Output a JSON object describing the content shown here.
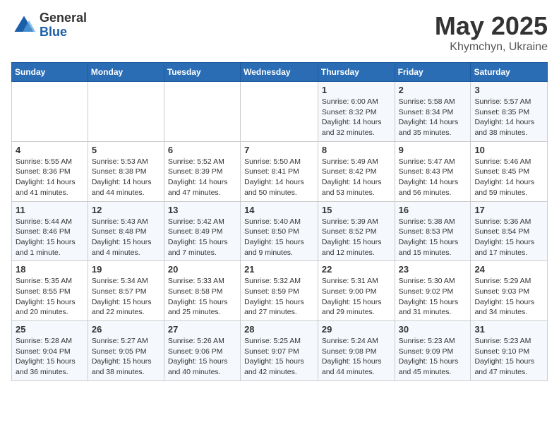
{
  "header": {
    "logo_general": "General",
    "logo_blue": "Blue",
    "month": "May 2025",
    "location": "Khymchyn, Ukraine"
  },
  "weekdays": [
    "Sunday",
    "Monday",
    "Tuesday",
    "Wednesday",
    "Thursday",
    "Friday",
    "Saturday"
  ],
  "weeks": [
    [
      {
        "day": "",
        "info": ""
      },
      {
        "day": "",
        "info": ""
      },
      {
        "day": "",
        "info": ""
      },
      {
        "day": "",
        "info": ""
      },
      {
        "day": "1",
        "info": "Sunrise: 6:00 AM\nSunset: 8:32 PM\nDaylight: 14 hours\nand 32 minutes."
      },
      {
        "day": "2",
        "info": "Sunrise: 5:58 AM\nSunset: 8:34 PM\nDaylight: 14 hours\nand 35 minutes."
      },
      {
        "day": "3",
        "info": "Sunrise: 5:57 AM\nSunset: 8:35 PM\nDaylight: 14 hours\nand 38 minutes."
      }
    ],
    [
      {
        "day": "4",
        "info": "Sunrise: 5:55 AM\nSunset: 8:36 PM\nDaylight: 14 hours\nand 41 minutes."
      },
      {
        "day": "5",
        "info": "Sunrise: 5:53 AM\nSunset: 8:38 PM\nDaylight: 14 hours\nand 44 minutes."
      },
      {
        "day": "6",
        "info": "Sunrise: 5:52 AM\nSunset: 8:39 PM\nDaylight: 14 hours\nand 47 minutes."
      },
      {
        "day": "7",
        "info": "Sunrise: 5:50 AM\nSunset: 8:41 PM\nDaylight: 14 hours\nand 50 minutes."
      },
      {
        "day": "8",
        "info": "Sunrise: 5:49 AM\nSunset: 8:42 PM\nDaylight: 14 hours\nand 53 minutes."
      },
      {
        "day": "9",
        "info": "Sunrise: 5:47 AM\nSunset: 8:43 PM\nDaylight: 14 hours\nand 56 minutes."
      },
      {
        "day": "10",
        "info": "Sunrise: 5:46 AM\nSunset: 8:45 PM\nDaylight: 14 hours\nand 59 minutes."
      }
    ],
    [
      {
        "day": "11",
        "info": "Sunrise: 5:44 AM\nSunset: 8:46 PM\nDaylight: 15 hours\nand 1 minute."
      },
      {
        "day": "12",
        "info": "Sunrise: 5:43 AM\nSunset: 8:48 PM\nDaylight: 15 hours\nand 4 minutes."
      },
      {
        "day": "13",
        "info": "Sunrise: 5:42 AM\nSunset: 8:49 PM\nDaylight: 15 hours\nand 7 minutes."
      },
      {
        "day": "14",
        "info": "Sunrise: 5:40 AM\nSunset: 8:50 PM\nDaylight: 15 hours\nand 9 minutes."
      },
      {
        "day": "15",
        "info": "Sunrise: 5:39 AM\nSunset: 8:52 PM\nDaylight: 15 hours\nand 12 minutes."
      },
      {
        "day": "16",
        "info": "Sunrise: 5:38 AM\nSunset: 8:53 PM\nDaylight: 15 hours\nand 15 minutes."
      },
      {
        "day": "17",
        "info": "Sunrise: 5:36 AM\nSunset: 8:54 PM\nDaylight: 15 hours\nand 17 minutes."
      }
    ],
    [
      {
        "day": "18",
        "info": "Sunrise: 5:35 AM\nSunset: 8:55 PM\nDaylight: 15 hours\nand 20 minutes."
      },
      {
        "day": "19",
        "info": "Sunrise: 5:34 AM\nSunset: 8:57 PM\nDaylight: 15 hours\nand 22 minutes."
      },
      {
        "day": "20",
        "info": "Sunrise: 5:33 AM\nSunset: 8:58 PM\nDaylight: 15 hours\nand 25 minutes."
      },
      {
        "day": "21",
        "info": "Sunrise: 5:32 AM\nSunset: 8:59 PM\nDaylight: 15 hours\nand 27 minutes."
      },
      {
        "day": "22",
        "info": "Sunrise: 5:31 AM\nSunset: 9:00 PM\nDaylight: 15 hours\nand 29 minutes."
      },
      {
        "day": "23",
        "info": "Sunrise: 5:30 AM\nSunset: 9:02 PM\nDaylight: 15 hours\nand 31 minutes."
      },
      {
        "day": "24",
        "info": "Sunrise: 5:29 AM\nSunset: 9:03 PM\nDaylight: 15 hours\nand 34 minutes."
      }
    ],
    [
      {
        "day": "25",
        "info": "Sunrise: 5:28 AM\nSunset: 9:04 PM\nDaylight: 15 hours\nand 36 minutes."
      },
      {
        "day": "26",
        "info": "Sunrise: 5:27 AM\nSunset: 9:05 PM\nDaylight: 15 hours\nand 38 minutes."
      },
      {
        "day": "27",
        "info": "Sunrise: 5:26 AM\nSunset: 9:06 PM\nDaylight: 15 hours\nand 40 minutes."
      },
      {
        "day": "28",
        "info": "Sunrise: 5:25 AM\nSunset: 9:07 PM\nDaylight: 15 hours\nand 42 minutes."
      },
      {
        "day": "29",
        "info": "Sunrise: 5:24 AM\nSunset: 9:08 PM\nDaylight: 15 hours\nand 44 minutes."
      },
      {
        "day": "30",
        "info": "Sunrise: 5:23 AM\nSunset: 9:09 PM\nDaylight: 15 hours\nand 45 minutes."
      },
      {
        "day": "31",
        "info": "Sunrise: 5:23 AM\nSunset: 9:10 PM\nDaylight: 15 hours\nand 47 minutes."
      }
    ]
  ]
}
